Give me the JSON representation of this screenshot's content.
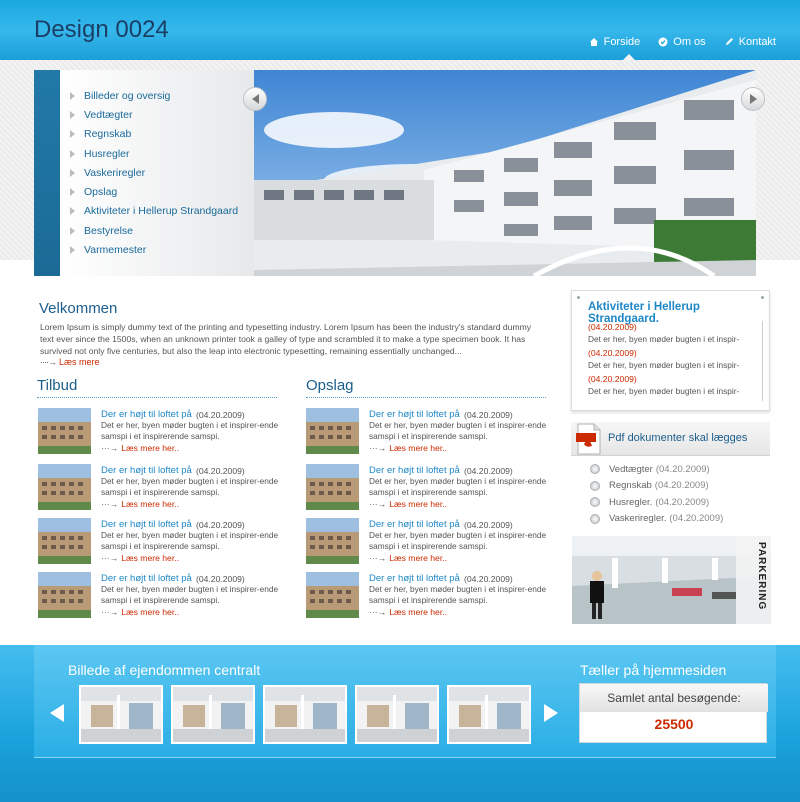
{
  "header": {
    "logo": "Design 0024",
    "nav": [
      {
        "label": "Forside",
        "icon": "home-icon"
      },
      {
        "label": "Om  os",
        "icon": "info-icon"
      },
      {
        "label": "Kontakt",
        "icon": "pencil-icon"
      }
    ]
  },
  "sidebar_menu": {
    "items": [
      "Billeder og oversig",
      "Vedtægter",
      "Regnskab",
      "Husregler",
      "Vaskeriregler",
      "Opslag",
      "Aktiviteter i Hellerup Strandgaard",
      "Bestyrelse",
      "Varmemester"
    ]
  },
  "welcome": {
    "title": "Velkommen",
    "text": "Lorem Ipsum is simply dummy text of the printing and typesetting industry. Lorem Ipsum has been the industry's standard dummy text ever since the 1500s, when an unknown printer took a galley of type and scrambled it to make a type specimen book. It has survived not only five centuries, but also the leap into electronic typesetting, remaining essentially unchanged...",
    "more": "Læs mere"
  },
  "tilbud": {
    "title": "Tilbud",
    "items": [
      {
        "title": "Der er højt til loftet på",
        "date": "(04.20.2009)",
        "body": "Det er her, byen møder bugten i et inspirer-ende samspi i et inspirerende samspi.",
        "more": "Læs mere her.."
      },
      {
        "title": "Der er højt til loftet på",
        "date": "(04.20.2009)",
        "body": "Det er her, byen møder bugten i et inspirer-ende samspi i et inspirerende samspi.",
        "more": "Læs mere her.."
      },
      {
        "title": "Der er højt til loftet på",
        "date": "(04.20.2009)",
        "body": "Det er her, byen møder bugten i et inspirer-ende samspi i et inspirerende samspi.",
        "more": "Læs mere her.."
      },
      {
        "title": "Der er højt til loftet på",
        "date": "(04.20.2009)",
        "body": "Det er her, byen møder bugten i et inspirer-ende samspi i et inspirerende samspi.",
        "more": "Læs mere her.."
      }
    ]
  },
  "opslag": {
    "title": "Opslag",
    "items": [
      {
        "title": "Der er højt til loftet på",
        "date": "(04.20.2009)",
        "body": "Det er her, byen møder bugten i et inspirer-ende samspi i et inspirerende samspi.",
        "more": "Læs mere her.."
      },
      {
        "title": "Der er højt til loftet på",
        "date": "(04.20.2009)",
        "body": "Det er her, byen møder bugten i et inspirer-ende samspi i et inspirerende samspi.",
        "more": "Læs mere her.."
      },
      {
        "title": "Der er højt til loftet på",
        "date": "(04.20.2009)",
        "body": "Det er her, byen møder bugten i et inspirer-ende samspi i et inspirerende samspi.",
        "more": "Læs mere her.."
      },
      {
        "title": "Der er højt til loftet på",
        "date": "(04.20.2009)",
        "body": "Det er her, byen møder bugten i et inspirer-ende samspi i et inspirerende samspi.",
        "more": "Læs mere her.."
      }
    ]
  },
  "activities": {
    "title": "Aktiviteter i Hellerup Strandgaard.",
    "items": [
      {
        "date": "(04.20.2009)",
        "text": "Det er her, byen møder bugten i et inspir-"
      },
      {
        "date": "(04.20.2009)",
        "text": "Det er her, byen møder bugten i et inspir-"
      },
      {
        "date": "(04.20.2009)",
        "text": "Det er her, byen møder bugten i et inspir-"
      }
    ]
  },
  "pdf": {
    "title": "Pdf dokumenter skal lægges",
    "icon_text": "PDF",
    "items": [
      {
        "name": "Vedtægter",
        "date": "(04.20.2009)"
      },
      {
        "name": "Regnskab",
        "date": "(04.20.2009)"
      },
      {
        "name": "Husregler.",
        "date": "(04.20.2009)"
      },
      {
        "name": "Vaskeriregler.",
        "date": "(04.20.2009)"
      }
    ]
  },
  "parking": {
    "label": "PARKERING"
  },
  "footer": {
    "gallery_title": "Billede af ejendommen centralt",
    "counter_title": "Tæller på hjemmesiden",
    "counter_label": "Samlet antal besøgende:",
    "counter_value": "25500"
  },
  "colors": {
    "accent": "#1aa8e0",
    "link": "#1e87c6",
    "heading": "#1b5e8c",
    "highlight": "#cc2a00"
  }
}
